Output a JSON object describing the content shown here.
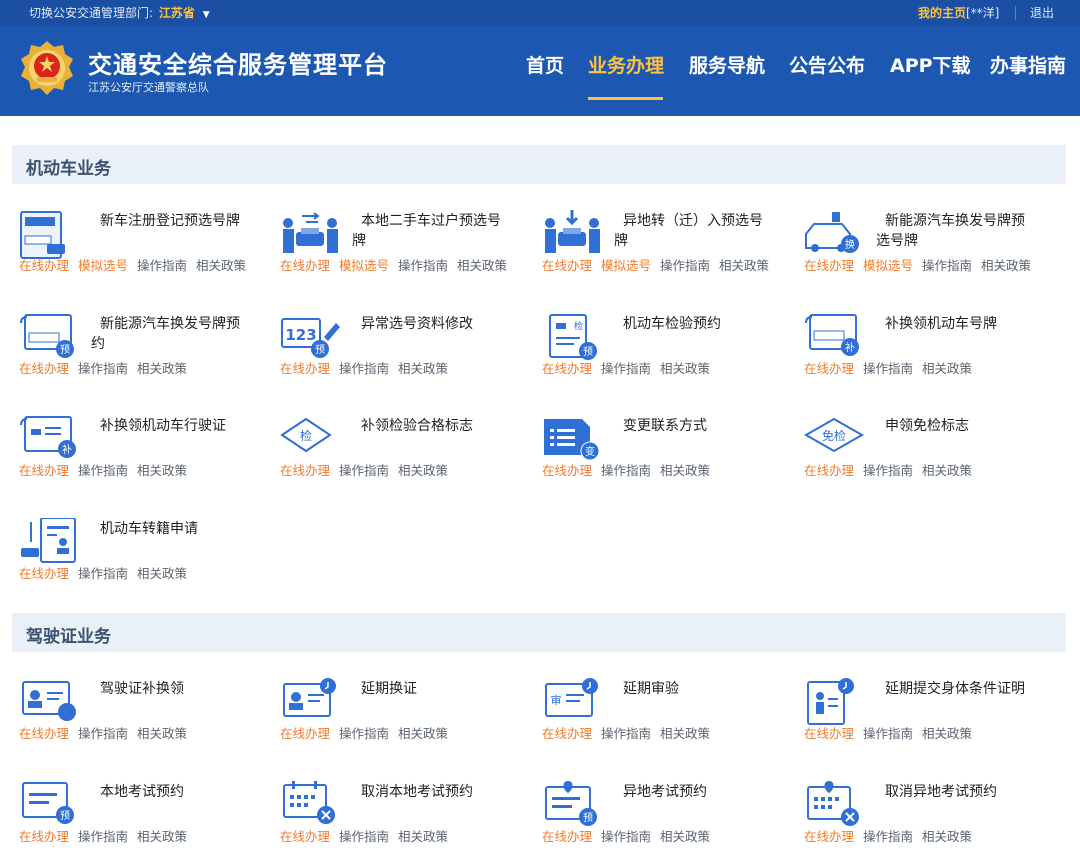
{
  "topbar": {
    "dept_label": "切换公安交通管理部门:",
    "dept_value": "江苏省",
    "home_link": "我的主页",
    "user": "[**洋]",
    "logout": "退出"
  },
  "header": {
    "title": "交通安全综合服务管理平台",
    "subtitle": "江苏公安厅交通警察总队",
    "nav": [
      "首页",
      "业务办理",
      "服务导航",
      "公告公布",
      "APP下载",
      "办事指南"
    ],
    "active_nav": "业务办理"
  },
  "links": {
    "online": "在线办理",
    "mock": "模拟选号",
    "guide": "操作指南",
    "policy": "相关政策"
  },
  "sections": [
    {
      "title": "机动车业务",
      "items": [
        {
          "name": "新车注册登记预选号牌",
          "icon": "new-plate-icon"
        },
        {
          "name": "本地二手车过户预选号牌",
          "icon": "car-transfer-icon"
        },
        {
          "name": "异地转（迁）入预选号牌",
          "icon": "car-relocate-icon"
        },
        {
          "name": "新能源汽车换发号牌预选号牌",
          "icon": "ev-plate-icon"
        },
        {
          "name": "新能源汽车换发号牌预约",
          "icon": "ev-reserve-icon"
        },
        {
          "name": "异常选号资料修改",
          "icon": "number-edit-icon"
        },
        {
          "name": "机动车检验预约",
          "icon": "inspection-reserve-icon"
        },
        {
          "name": "补换领机动车号牌",
          "icon": "plate-replace-icon"
        },
        {
          "name": "补换领机动车行驶证",
          "icon": "license-replace-icon"
        },
        {
          "name": "补领检验合格标志",
          "icon": "inspection-sticker-icon"
        },
        {
          "name": "变更联系方式",
          "icon": "contact-change-icon"
        },
        {
          "name": "申领免检标志",
          "icon": "exempt-sticker-icon"
        },
        {
          "name": "机动车转籍申请",
          "icon": "car-register-transfer-icon"
        }
      ]
    },
    {
      "title": "驾驶证业务",
      "items": [
        {
          "name": "驾驶证补换领",
          "icon": "driver-license-icon"
        },
        {
          "name": "延期换证",
          "icon": "extend-license-icon"
        },
        {
          "name": "延期审验",
          "icon": "extend-review-icon"
        },
        {
          "name": "延期提交身体条件证明",
          "icon": "health-cert-icon"
        },
        {
          "name": "本地考试预约",
          "icon": "exam-reserve-icon"
        },
        {
          "name": "取消本地考试预约",
          "icon": "cancel-exam-icon"
        },
        {
          "name": "异地考试预约",
          "icon": "remote-exam-icon"
        },
        {
          "name": "取消异地考试预约",
          "icon": "cancel-remote-exam-icon"
        }
      ]
    }
  ],
  "colors": {
    "header_bg": "#1c57b1",
    "accent": "#ffc23d",
    "link_orange": "#f07c2d",
    "icon_blue": "#2f6fd6"
  }
}
